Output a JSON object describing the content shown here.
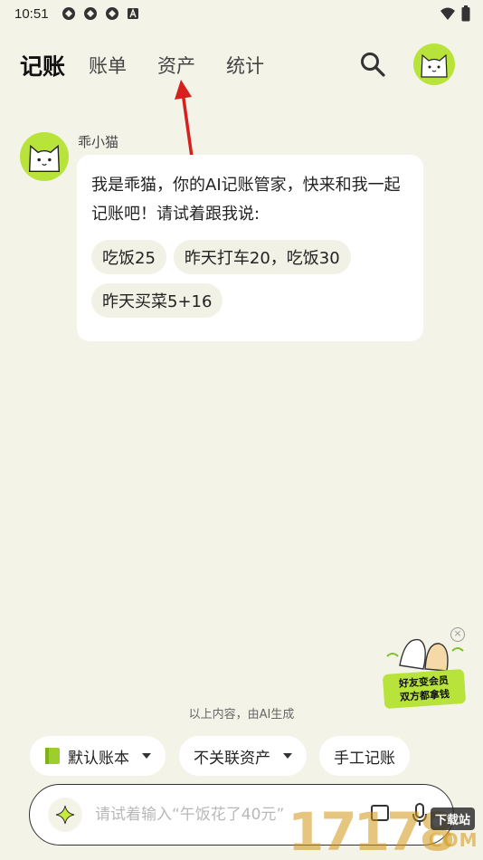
{
  "status_bar": {
    "time": "10:51",
    "left_icons": [
      "sync-icon",
      "sync-icon",
      "sync-icon",
      "a-badge-icon"
    ],
    "right_icons": [
      "wifi-icon",
      "battery-icon"
    ]
  },
  "nav": {
    "tabs": [
      {
        "label": "记账",
        "active": true
      },
      {
        "label": "账单",
        "active": false
      },
      {
        "label": "资产",
        "active": false
      },
      {
        "label": "统计",
        "active": false
      }
    ]
  },
  "chat": {
    "bot_name": "乖小猫",
    "message": "我是乖猫，你的AI记账管家，快来和我一起记账吧！请试着跟我说:",
    "suggestions": [
      "吃饭25",
      "昨天打车20，吃饭30",
      "昨天买菜5+16"
    ]
  },
  "promo": {
    "line1": "好友变会员",
    "line2": "双方都拿钱",
    "close": "×"
  },
  "ai_note": "以上内容，由AI生成",
  "quick_actions": {
    "book": "默认账本",
    "asset": "不关联资产",
    "manual": "手工记账"
  },
  "input": {
    "placeholder": "请试着输入“午饭花了40元”"
  },
  "watermark": {
    "digits": "17178",
    "tag": "下载站",
    "domain": "COM"
  },
  "colors": {
    "background": "#f4f3e8",
    "accent_green": "#b7e33a",
    "annotation_arrow": "#e02020"
  }
}
